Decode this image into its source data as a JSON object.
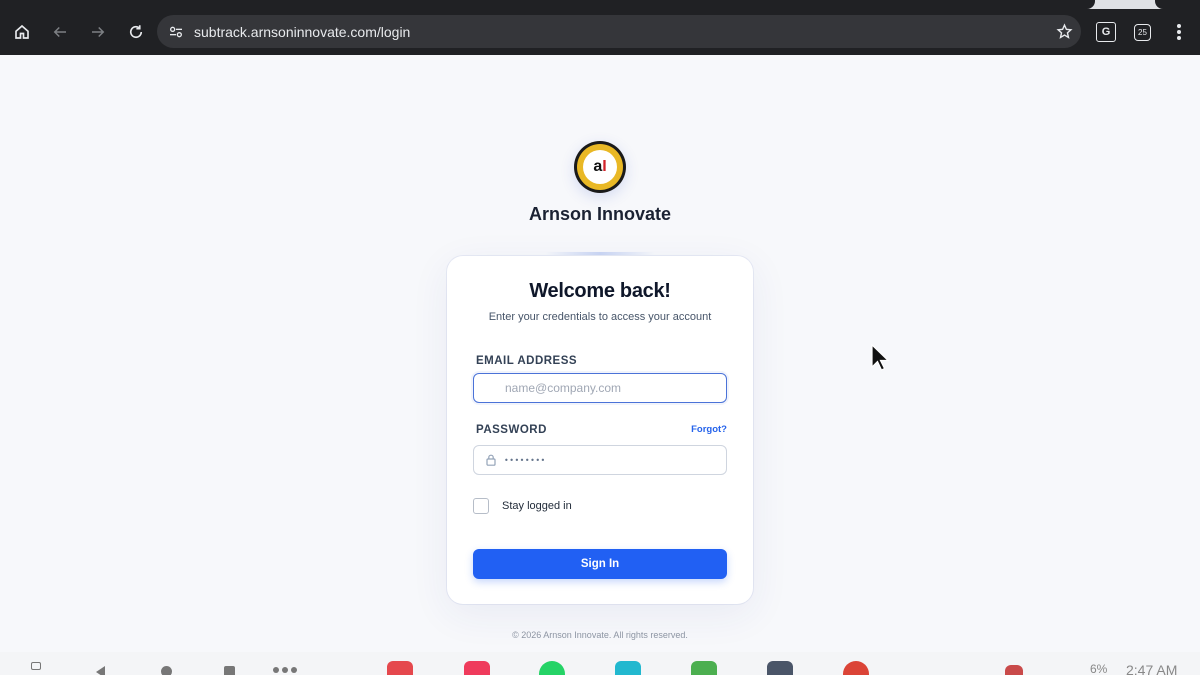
{
  "browser": {
    "url": "subtrack.arnsoninnovate.com/login",
    "translate_glyph": "G",
    "tab_count": "25",
    "icons": [
      "home-icon",
      "back-icon",
      "forward-icon",
      "reload-icon",
      "site-info-icon",
      "star-icon",
      "translate-icon",
      "tab-counter-icon",
      "menu-icon"
    ]
  },
  "brand": {
    "logo_text_a": "a",
    "logo_text_i": "I",
    "name": "Arnson Innovate"
  },
  "login": {
    "title": "Welcome back!",
    "subtitle": "Enter your credentials to access your account",
    "email_label": "EMAIL ADDRESS",
    "email_placeholder": "name@company.com",
    "password_label": "PASSWORD",
    "forgot_label": "Forgot?",
    "password_value": "••••••••",
    "remember_label": "Stay logged in",
    "remember_checked": false,
    "submit_label": "Sign In",
    "accent_color": "#2160f3"
  },
  "footer": {
    "text": "© 2026 Arnson Innovate. All rights reserved."
  },
  "taskbar": {
    "battery": "6%",
    "time": "2:47 AM"
  }
}
